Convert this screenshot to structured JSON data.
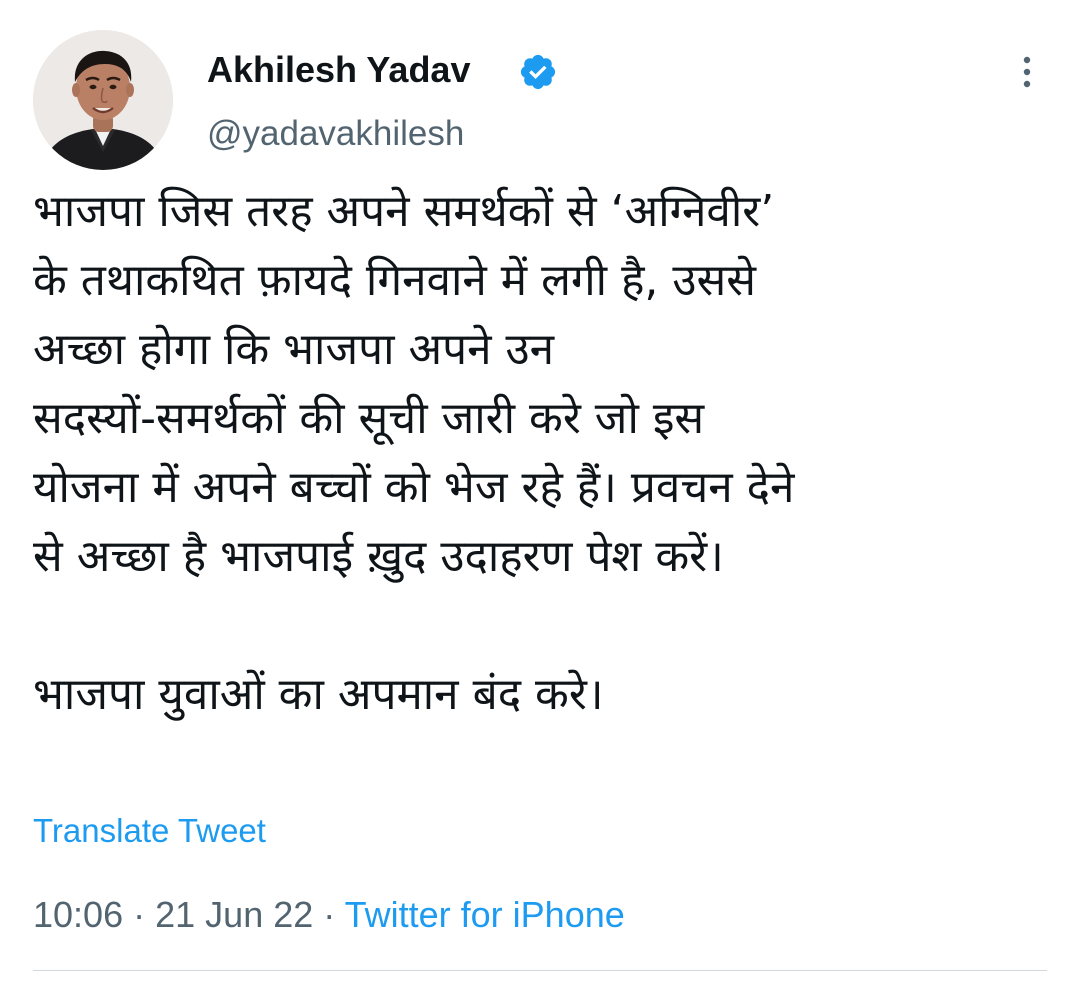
{
  "tweet": {
    "author": {
      "name": "Akhilesh Yadav",
      "handle": "@yadavakhilesh",
      "verified": true,
      "avatar_icon": "profile-photo"
    },
    "menu_icon": "more-vertical-icon",
    "text_paragraph_1": "भाजपा जिस तरह अपने समर्थकों से ‘अग्निवीर’\nके तथाकथित फ़ायदे गिनवाने में लगी है, उससे\nअच्छा होगा कि भाजपा अपने उन\nसदस्यों-समर्थकों की सूची जारी करे जो इस\nयोजना में अपने बच्चों को भेज रहे हैं। प्रवचन देने\nसे अच्छा है भाजपाई ख़ुद उदाहरण पेश करें।",
    "text_paragraph_2": "भाजपा युवाओं का अपमान बंद करे।",
    "translate_label": "Translate Tweet",
    "time": "10:06",
    "date": "21 Jun 22",
    "separator": "·",
    "source": "Twitter for iPhone",
    "colors": {
      "link": "#1d9bf0",
      "secondary_text": "#536471",
      "primary_text": "#0f1419",
      "verified_badge": "#1d9bf0",
      "divider": "#cfd9de"
    }
  }
}
